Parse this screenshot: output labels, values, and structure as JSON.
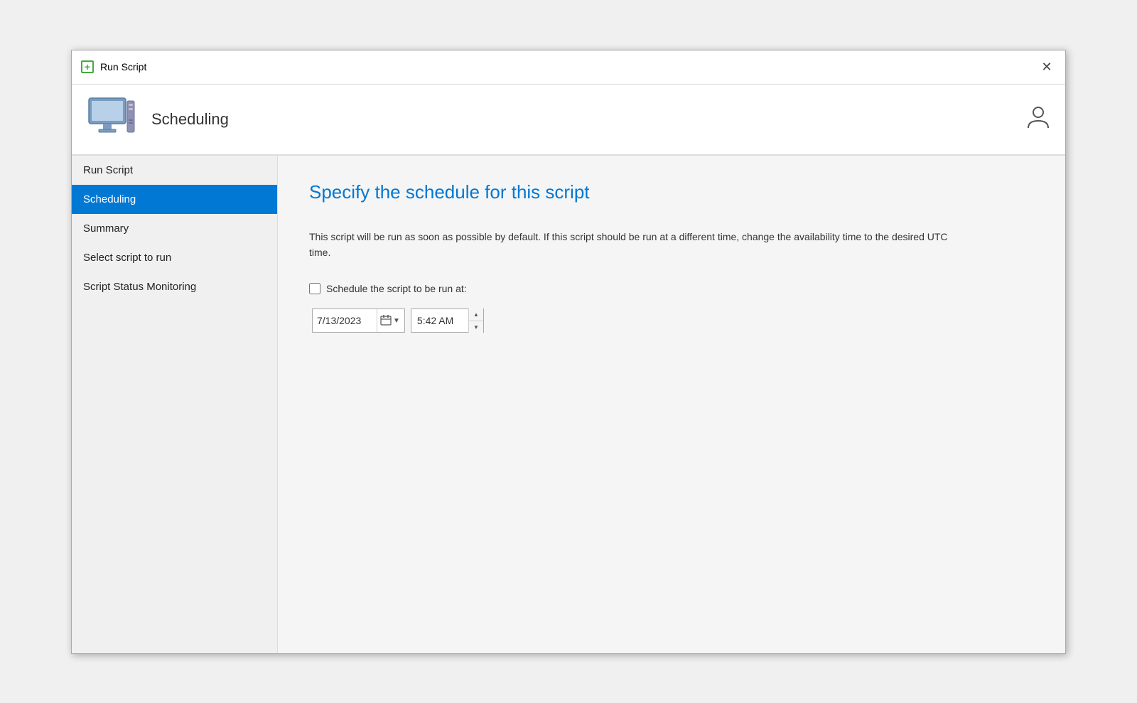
{
  "titleBar": {
    "title": "Run Script",
    "closeLabel": "✕"
  },
  "header": {
    "title": "Scheduling",
    "userIconLabel": "👤"
  },
  "sidebar": {
    "items": [
      {
        "label": "Run Script",
        "active": false
      },
      {
        "label": "Scheduling",
        "active": true
      },
      {
        "label": "Summary",
        "active": false
      },
      {
        "label": "Select script to run",
        "active": false
      },
      {
        "label": "Script Status Monitoring",
        "active": false
      }
    ]
  },
  "main": {
    "title": "Specify the schedule for this script",
    "description": "This script will be run as soon as possible by default. If this script should be run at a different time, change the availability time to the desired UTC time.",
    "scheduleCheckboxLabel": "Schedule the script to be run at:",
    "dateValue": "7/13/2023",
    "timeValue": "5:42 AM"
  }
}
